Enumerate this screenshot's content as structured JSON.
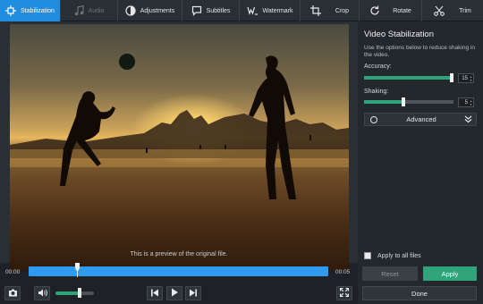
{
  "toolbar": {
    "tabs": [
      {
        "label": "Stabilization",
        "icon": "stabilization-icon",
        "state": "active"
      },
      {
        "label": "Audio",
        "icon": "music-note-icon",
        "state": "disabled"
      },
      {
        "label": "Adjustments",
        "icon": "adjustments-icon",
        "state": "normal"
      },
      {
        "label": "Subtitles",
        "icon": "speech-bubble-icon",
        "state": "normal"
      },
      {
        "label": "Watermark",
        "icon": "watermark-icon",
        "state": "normal"
      },
      {
        "label": "Crop",
        "icon": "crop-icon",
        "state": "normal"
      },
      {
        "label": "Rotate",
        "icon": "rotate-icon",
        "state": "normal"
      },
      {
        "label": "Trim",
        "icon": "scissors-icon",
        "state": "normal"
      }
    ]
  },
  "preview": {
    "caption": "This is a preview of the original file."
  },
  "timeline": {
    "start_time": "00:00",
    "end_time": "00:05"
  },
  "controls": {
    "snapshot_icon": "camera-icon",
    "volume_icon": "speaker-icon",
    "volume_level": 0.6,
    "prev_icon": "skip-previous-icon",
    "play_icon": "play-icon",
    "next_icon": "skip-next-icon",
    "fullscreen_icon": "fullscreen-icon"
  },
  "panel": {
    "title": "Video Stabilization",
    "description": "Use the options below to reduce shaking in the video.",
    "accuracy": {
      "label": "Accuracy:",
      "value": "15",
      "fraction": 0.98
    },
    "shaking": {
      "label": "Shaking:",
      "value": "5",
      "fraction": 0.44
    },
    "advanced_label": "Advanced",
    "apply_all_label": "Apply to all files",
    "reset_label": "Reset",
    "apply_label": "Apply",
    "done_label": "Done"
  },
  "colors": {
    "accent_blue": "#1f8ee0",
    "accent_green": "#2fa37a",
    "timeline": "#2e9af0"
  }
}
